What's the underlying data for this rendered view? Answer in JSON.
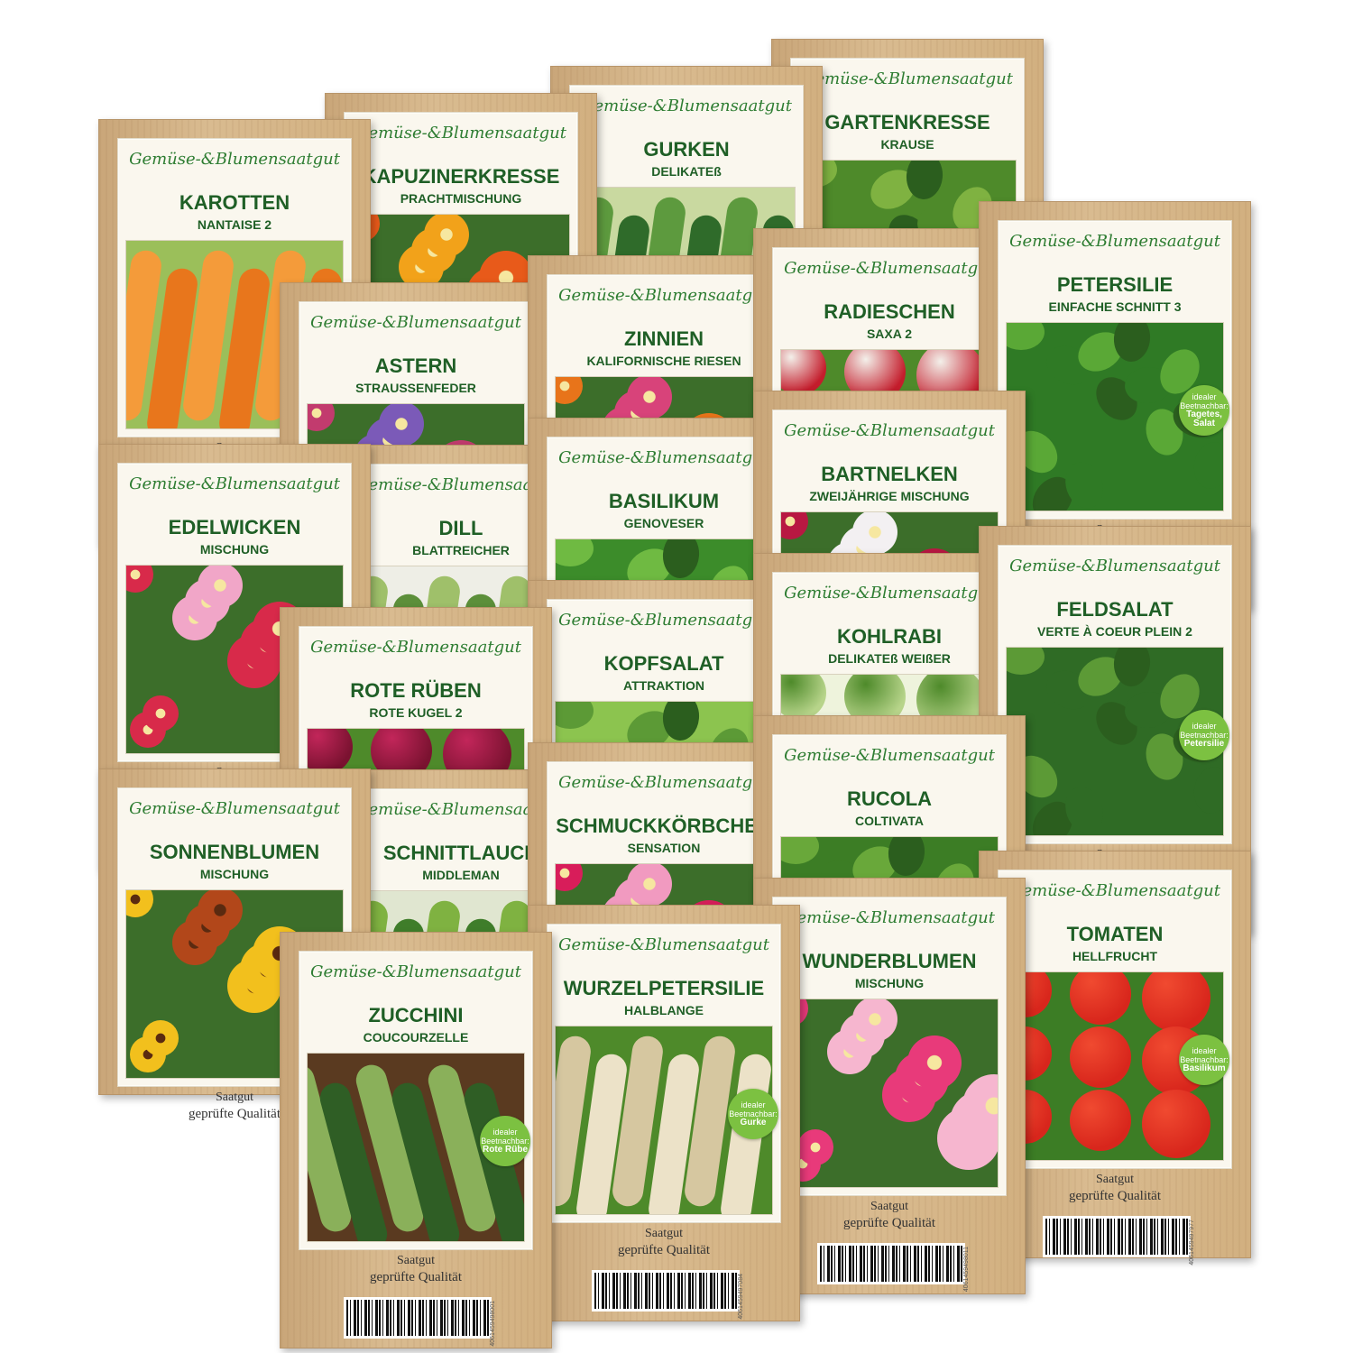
{
  "brand_text": "Gemüse-&Blumensaatgut",
  "footer": {
    "saatgut": "Saatgut",
    "quality": "geprüfte Qualität"
  },
  "packets": [
    {
      "title": "KAROTTEN",
      "subtitle": "NANTAISE 2",
      "photo": "carrots",
      "colors": [
        "#e8761c",
        "#f49b3a",
        "#9bbf5a"
      ]
    },
    {
      "title": "KAPUZINERKRESSE",
      "subtitle": "PRACHTMISCHUNG",
      "photo": "nasturtium",
      "colors": [
        "#e85a1a",
        "#f2a21a",
        "#3b7d2e"
      ]
    },
    {
      "title": "GURKEN",
      "subtitle": "DELIKATEß",
      "photo": "cucumbers",
      "colors": [
        "#2f6b2a",
        "#5d9a3e",
        "#c9d9a0"
      ]
    },
    {
      "title": "GARTENKRESSE",
      "subtitle": "KRAUSE",
      "photo": "cress",
      "colors": [
        "#4e8a2a",
        "#7fb241",
        "#c7d98a"
      ]
    },
    {
      "title": "PETERSILIE",
      "subtitle": "EINFACHE SCHNITT 3",
      "photo": "parsley",
      "colors": [
        "#2f7a25",
        "#5aa836",
        "#f2c51d"
      ],
      "badge": {
        "line1": "idealer",
        "line2": "Beetnachbar:",
        "line3": "Tagetes, Salat"
      }
    },
    {
      "title": "RADIESCHEN",
      "subtitle": "SAXA 2",
      "photo": "radish",
      "colors": [
        "#c41d2c",
        "#f3f0ea",
        "#4e8a2a"
      ]
    },
    {
      "title": "ZINNIEN",
      "subtitle": "KALIFORNISCHE RIESEN",
      "photo": "zinnia",
      "colors": [
        "#e8741a",
        "#d8437a",
        "#f2c01d"
      ]
    },
    {
      "title": "ASTERN",
      "subtitle": "STRAUSSENFEDER",
      "photo": "aster",
      "colors": [
        "#c23b6e",
        "#7b5ab8",
        "#e6e0f0"
      ]
    },
    {
      "title": "BARTNELKEN",
      "subtitle": "ZWEIJÄHRIGE MISCHUNG",
      "photo": "dianthus",
      "colors": [
        "#b81842",
        "#f3f0f2",
        "#8a1230"
      ]
    },
    {
      "title": "BASILIKUM",
      "subtitle": "GENOVESER",
      "photo": "basil",
      "colors": [
        "#3c8c2a",
        "#6fba42",
        "#2b5e1e"
      ]
    },
    {
      "title": "DILL",
      "subtitle": "BLATTREICHER",
      "photo": "dill",
      "colors": [
        "#5c8f3a",
        "#9fc06a",
        "#eeeee6"
      ]
    },
    {
      "title": "EDELWICKEN",
      "subtitle": "MISCHUNG",
      "photo": "sweetpea",
      "colors": [
        "#d82a4a",
        "#f1a6c8",
        "#7d5ab0"
      ]
    },
    {
      "title": "FELDSALAT",
      "subtitle": "VERTE À COEUR PLEIN 2",
      "photo": "lambslettuce",
      "colors": [
        "#2f6b25",
        "#5c9a36",
        "#d9434a"
      ],
      "badge": {
        "line1": "idealer",
        "line2": "Beetnachbar:",
        "line3": "Petersilie"
      }
    },
    {
      "title": "KOHLRABI",
      "subtitle": "DELIKATEß WEIßER",
      "photo": "kohlrabi",
      "colors": [
        "#b7d48a",
        "#4e8a2a",
        "#eef3dc"
      ]
    },
    {
      "title": "KOPFSALAT",
      "subtitle": "ATTRAKTION",
      "photo": "lettuce",
      "colors": [
        "#8cc44f",
        "#5c9a36",
        "#d8ecb0"
      ]
    },
    {
      "title": "ROTE RÜBEN",
      "subtitle": "ROTE KUGEL 2",
      "photo": "beets",
      "colors": [
        "#7a1230",
        "#c2265a",
        "#4e8a2a"
      ]
    },
    {
      "title": "RUCOLA",
      "subtitle": "COLTIVATA",
      "photo": "rocket",
      "colors": [
        "#3c7d25",
        "#69a83a",
        "#e8e2cf"
      ]
    },
    {
      "title": "SCHMUCKKÖRBCHEN",
      "subtitle": "SENSATION",
      "photo": "cosmos",
      "colors": [
        "#d81d5a",
        "#f19ac0",
        "#4e8a2a"
      ]
    },
    {
      "title": "SCHNITTLAUCH",
      "subtitle": "MIDDLEMAN",
      "photo": "chives",
      "colors": [
        "#3f7d2a",
        "#7fb241",
        "#e0e6d0"
      ]
    },
    {
      "title": "SONNENBLUMEN",
      "subtitle": "MISCHUNG",
      "photo": "sunflower",
      "colors": [
        "#f2c01d",
        "#b2471a",
        "#5a2a10"
      ]
    },
    {
      "title": "TOMATEN",
      "subtitle": "HELLFRUCHT",
      "photo": "tomatoes",
      "colors": [
        "#d8261c",
        "#f04a30",
        "#3c7d25"
      ],
      "badge": {
        "line1": "idealer",
        "line2": "Beetnachbar:",
        "line3": "Basilikum"
      }
    },
    {
      "title": "WUNDERBLUMEN",
      "subtitle": "MISCHUNG",
      "photo": "fouroclock",
      "colors": [
        "#e83a7a",
        "#f6b6cf",
        "#f2f0e8"
      ]
    },
    {
      "title": "WURZELPETERSILIE",
      "subtitle": "HALBLANGE",
      "photo": "parsnip",
      "colors": [
        "#ece2c8",
        "#d6c7a0",
        "#4e8a2a"
      ],
      "badge": {
        "line1": "idealer",
        "line2": "Beetnachbar:",
        "line3": "Gurke"
      }
    },
    {
      "title": "ZUCCHINI",
      "subtitle": "COUCOURZELLE",
      "photo": "zucchini",
      "colors": [
        "#2f5e25",
        "#8ab05a",
        "#5a3a20"
      ],
      "badge": {
        "line1": "idealer",
        "line2": "Beetnachbar:",
        "line3": "Rote Rübe"
      }
    }
  ],
  "barcodes": [
    "4061459498001",
    "4061459497084",
    "4061459498011",
    "4061459497977"
  ]
}
